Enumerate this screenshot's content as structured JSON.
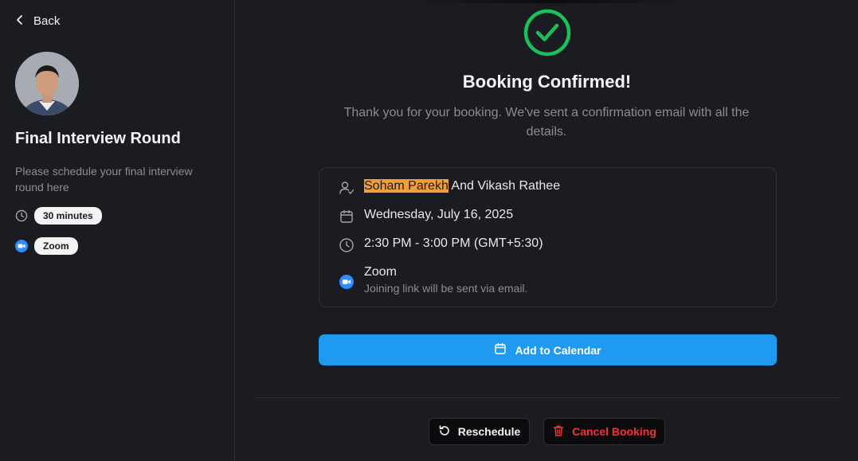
{
  "sidebar": {
    "back_label": "Back",
    "event_title": "Final Interview Round",
    "event_description": "Please schedule your final interview round here",
    "duration": "30 minutes",
    "location": "Zoom"
  },
  "confirmation": {
    "title": "Booking Confirmed!",
    "subtitle": "Thank you for your booking. We've sent a confirmation email with all the details."
  },
  "details": {
    "attendee_highlighted": "Soham Parekh",
    "attendee_rest": " And Vikash Rathee",
    "date": "Wednesday, July 16, 2025",
    "time": "2:30 PM - 3:00 PM (GMT+5:30)",
    "location_name": "Zoom",
    "location_note": "Joining link will be sent via email."
  },
  "actions": {
    "add_to_calendar": "Add to Calendar",
    "reschedule": "Reschedule",
    "cancel_booking": "Cancel Booking"
  },
  "colors": {
    "background": "#1b1c21",
    "accent_blue": "#1e9bf0",
    "success_green": "#19c15a",
    "danger_red": "#ef3434",
    "highlight_orange": "#f29d38"
  },
  "icons": {
    "back": "chevron-left-icon",
    "duration": "clock-icon",
    "location": "zoom-icon",
    "success": "check-circle-icon",
    "attendees": "user-check-icon",
    "date": "calendar-icon",
    "time": "clock-icon",
    "reschedule": "rotate-ccw-icon",
    "cancel": "trash-icon"
  }
}
